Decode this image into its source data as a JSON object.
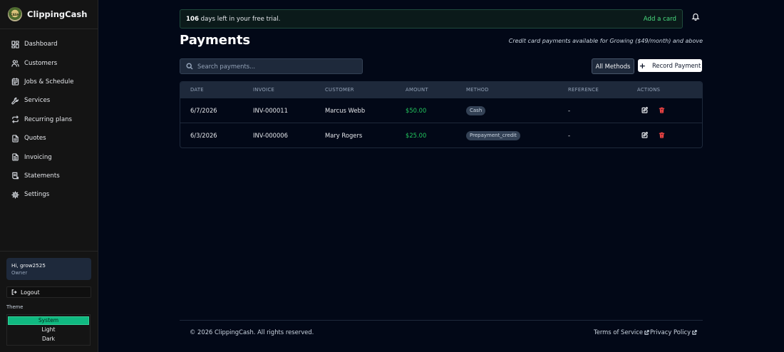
{
  "brand": {
    "name": "ClippingCash",
    "logo_text": "CASH"
  },
  "sidebar": {
    "items": [
      {
        "label": "Dashboard",
        "icon": "dashboard-icon"
      },
      {
        "label": "Customers",
        "icon": "users-icon"
      },
      {
        "label": "Jobs & Schedule",
        "icon": "calendar-icon"
      },
      {
        "label": "Services",
        "icon": "wrench-icon"
      },
      {
        "label": "Recurring plans",
        "icon": "repeat-icon"
      },
      {
        "label": "Quotes",
        "icon": "document-icon"
      },
      {
        "label": "Invoicing",
        "icon": "invoice-icon"
      },
      {
        "label": "Statements",
        "icon": "statement-icon"
      },
      {
        "label": "Settings",
        "icon": "gear-icon"
      }
    ],
    "user": {
      "greeting": "Hi, grow2525",
      "role": "Owner"
    },
    "logout_label": "Logout",
    "theme_label": "Theme",
    "theme_options": [
      "System",
      "Light",
      "Dark"
    ],
    "theme_selected": "System"
  },
  "trial": {
    "days": "106",
    "text": " days left in your free trial.",
    "cta": "Add a card"
  },
  "header": {
    "title": "Payments",
    "note": "Credit card payments available for Growing ($49/month) and above"
  },
  "search": {
    "placeholder": "Search payments...",
    "value": ""
  },
  "filter": {
    "methods_label": "All Methods"
  },
  "record_button": {
    "label": "Record Payment"
  },
  "table": {
    "columns": [
      "DATE",
      "INVOICE",
      "CUSTOMER",
      "AMOUNT",
      "METHOD",
      "REFERENCE",
      "ACTIONS"
    ],
    "rows": [
      {
        "date": "6/7/2026",
        "invoice": "INV-000011",
        "customer": "Marcus Webb",
        "amount": "$50.00",
        "method": "Cash",
        "reference": "-"
      },
      {
        "date": "6/3/2026",
        "invoice": "INV-000006",
        "customer": "Mary Rogers",
        "amount": "$25.00",
        "method": "Prepayment_credit",
        "reference": "-"
      }
    ]
  },
  "footer": {
    "copyright": "© 2026 ClippingCash. All rights reserved.",
    "terms": "Terms of Service",
    "privacy": "Privacy Policy"
  },
  "colors": {
    "accent": "#10b981",
    "amount": "#22c55e",
    "danger": "#ef4444",
    "background": "#020817"
  }
}
